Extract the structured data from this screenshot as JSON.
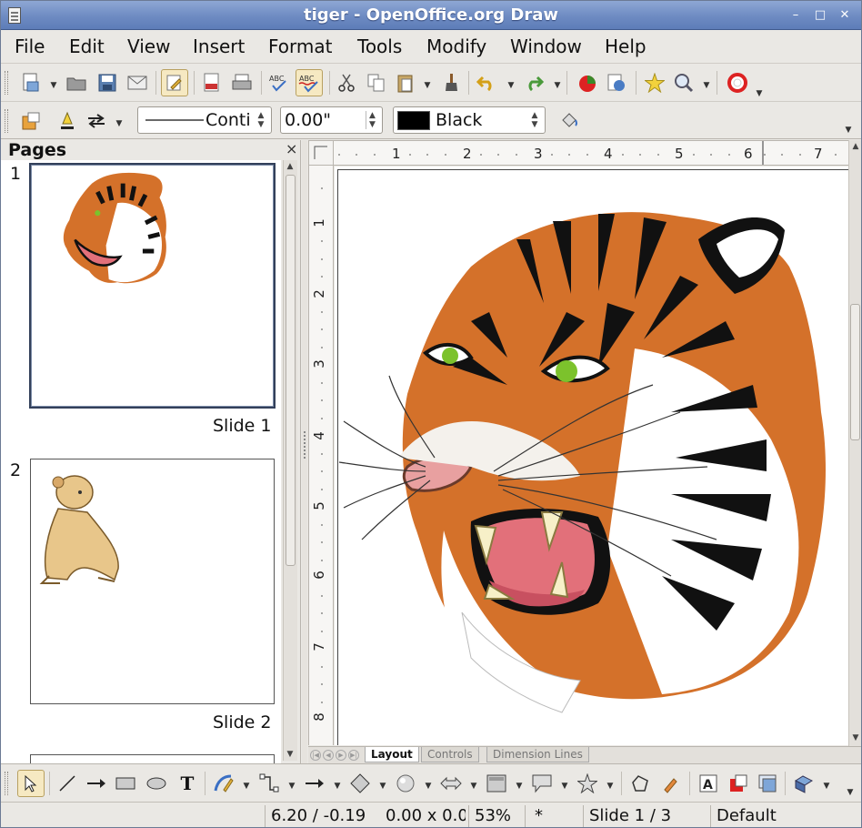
{
  "window": {
    "title": "tiger - OpenOffice.org Draw",
    "controls": [
      "–",
      "□",
      "✕"
    ]
  },
  "menu": [
    "File",
    "Edit",
    "View",
    "Insert",
    "Format",
    "Tools",
    "Modify",
    "Window",
    "Help"
  ],
  "standard_toolbar": {
    "icons": [
      "new-icon",
      "open-icon",
      "save-icon",
      "email-icon",
      "edit-file-icon",
      "export-pdf-icon",
      "print-icon",
      "spellcheck-icon",
      "autospellcheck-icon",
      "cut-icon",
      "copy-icon",
      "paste-icon",
      "format-paintbrush-icon",
      "undo-icon",
      "redo-icon",
      "chart-icon",
      "navigator-icon",
      "gallery-icon",
      "zoom-icon",
      "help-icon"
    ]
  },
  "line_toolbar": {
    "line_style": "Conti",
    "line_width": "0.00\"",
    "line_color_name": "Black",
    "line_color": "#000000"
  },
  "pages_pane": {
    "title": "Pages",
    "close": "×",
    "slides": [
      {
        "number": "1",
        "label": "Slide 1",
        "selected": true
      },
      {
        "number": "2",
        "label": "Slide 2",
        "selected": false
      }
    ]
  },
  "rulers": {
    "horizontal": [
      "1",
      "2",
      "3",
      "4",
      "5",
      "6",
      "7"
    ],
    "vertical": [
      "1",
      "2",
      "3",
      "4",
      "5",
      "6",
      "7",
      "8"
    ]
  },
  "layer_tabs": [
    "Layout",
    "Controls",
    "Dimension Lines"
  ],
  "status": {
    "position": "6.20 / -0.19",
    "size": "0.00 x 0.0",
    "zoom": "53%",
    "modified": "*",
    "slide": "Slide 1 / 3",
    "layout": "Default"
  },
  "colors": {
    "titlebar": "#6e8bc2",
    "tiger_orange": "#d4712a",
    "tiger_eye": "#7cc22c",
    "tiger_mouth": "#e2707a"
  }
}
